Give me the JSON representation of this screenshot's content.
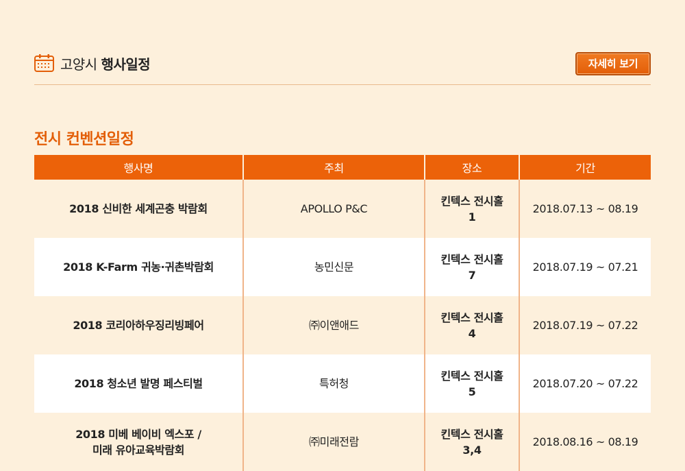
{
  "header": {
    "title_prefix": "고양시",
    "title_bold": "행사일정",
    "more_button": "자세히 보기"
  },
  "colors": {
    "accent": "#ec6209",
    "background": "#fdf0dc",
    "section_title": "#e35e08"
  },
  "icons": {
    "header_icon": "calendar-icon"
  },
  "section": {
    "title": "전시 컨벤션일정"
  },
  "table": {
    "columns": [
      "행사명",
      "주최",
      "장소",
      "기간"
    ],
    "rows": [
      {
        "name": "2018 신비한 세계곤충 박람회",
        "host": "APOLLO P&C",
        "venue": "킨텍스 전시홀\n1",
        "period": "2018.07.13 ~ 08.19"
      },
      {
        "name": "2018 K-Farm 귀농·귀촌박람회",
        "host": "농민신문",
        "venue": "킨텍스 전시홀\n7",
        "period": "2018.07.19 ~ 07.21"
      },
      {
        "name": "2018 코리아하우징리빙페어",
        "host": "㈜이앤애드",
        "venue": "킨텍스 전시홀\n4",
        "period": "2018.07.19 ~ 07.22"
      },
      {
        "name": "2018 청소년 발명 페스티벌",
        "host": "특허청",
        "venue": "킨텍스 전시홀\n5",
        "period": "2018.07.20 ~ 07.22"
      },
      {
        "name": "2018 미베 베이비 엑스포 /\n미래 유아교육박람회",
        "host": "㈜미래전람",
        "venue": "킨텍스 전시홀\n3,4",
        "period": "2018.08.16 ~ 08.19"
      }
    ]
  }
}
